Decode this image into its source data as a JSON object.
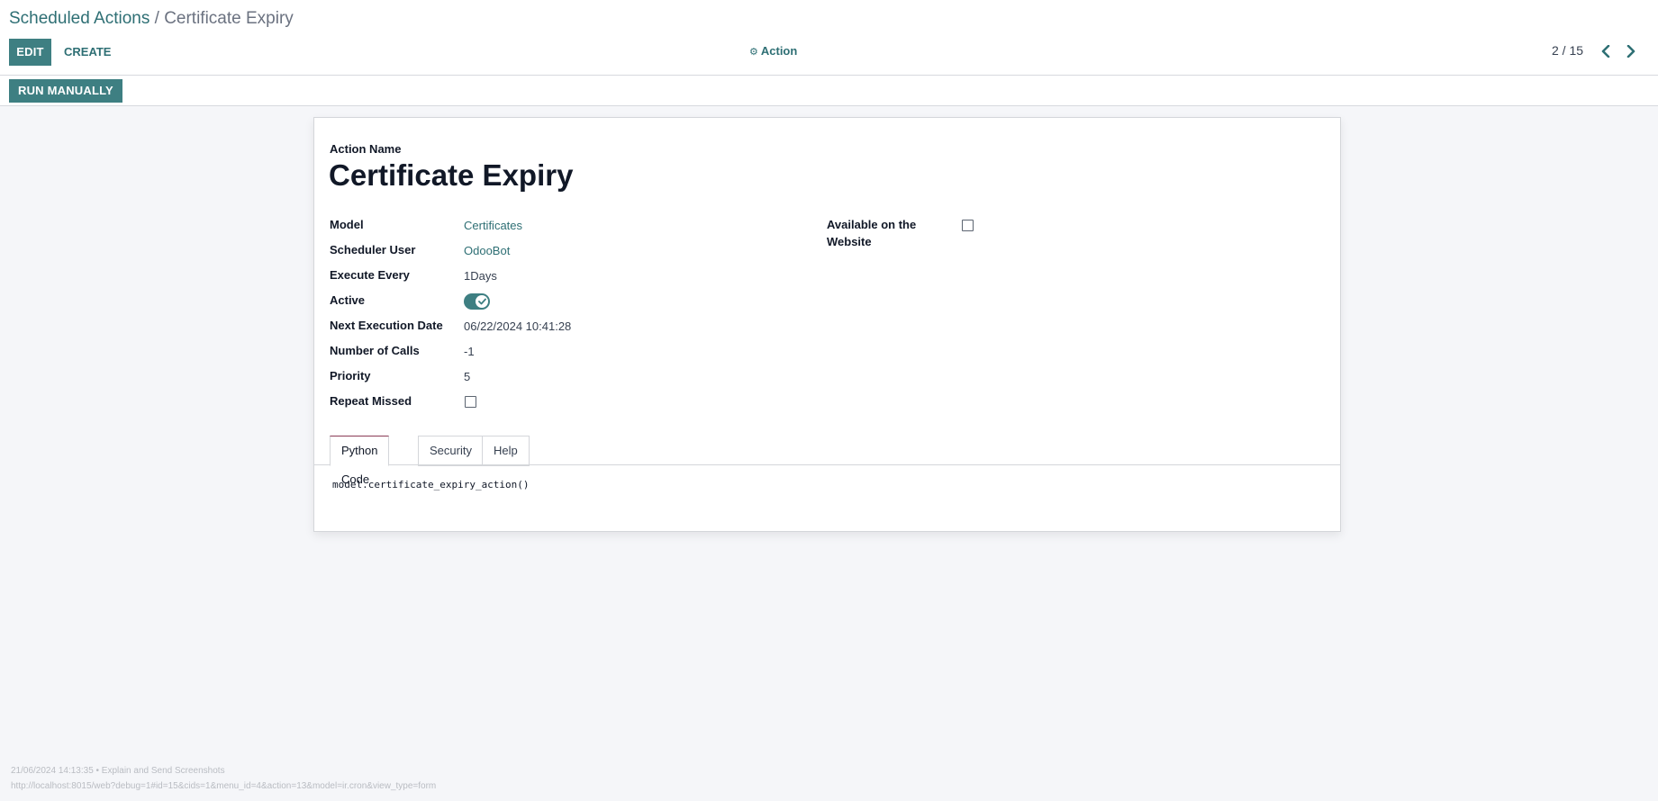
{
  "breadcrumb": {
    "parent": "Scheduled Actions",
    "separator": "/",
    "current": "Certificate Expiry"
  },
  "toolbar": {
    "edit_label": "EDIT",
    "create_label": "CREATE",
    "action_label": "Action",
    "action_icon": "gear-icon",
    "pager": "2 / 15"
  },
  "statusbar": {
    "run_label": "RUN MANUALLY"
  },
  "form": {
    "name_label": "Action Name",
    "name": "Certificate Expiry",
    "fields": {
      "model_label": "Model",
      "model_value": "Certificates",
      "user_label": "Scheduler User",
      "user_value": "OdooBot",
      "interval_label": "Execute Every",
      "interval_value": "1Days",
      "active_label": "Active",
      "active_value": true,
      "next_label": "Next Execution Date",
      "next_value": "06/22/2024 10:41:28",
      "calls_label": "Number of Calls",
      "calls_value": "-1",
      "priority_label": "Priority",
      "priority_value": "5",
      "repeat_label": "Repeat Missed",
      "repeat_value": false,
      "website_label_1": "Available on the",
      "website_label_2": "Website",
      "website_value": false
    },
    "tabs": [
      "Python Code",
      "Security",
      "Help"
    ],
    "active_tab": "Python Code",
    "code": "model.certificate_expiry_action()"
  },
  "footer": {
    "line1": "21/06/2024 14:13:35 • Explain and Send Screenshots",
    "line2": "http://localhost:8015/web?debug=1#id=15&cids=1&menu_id=4&action=13&model=ir.cron&view_type=form"
  },
  "colors": {
    "accent": "#3e7f82",
    "link": "#2e6f74",
    "background": "#f5f6f9"
  }
}
